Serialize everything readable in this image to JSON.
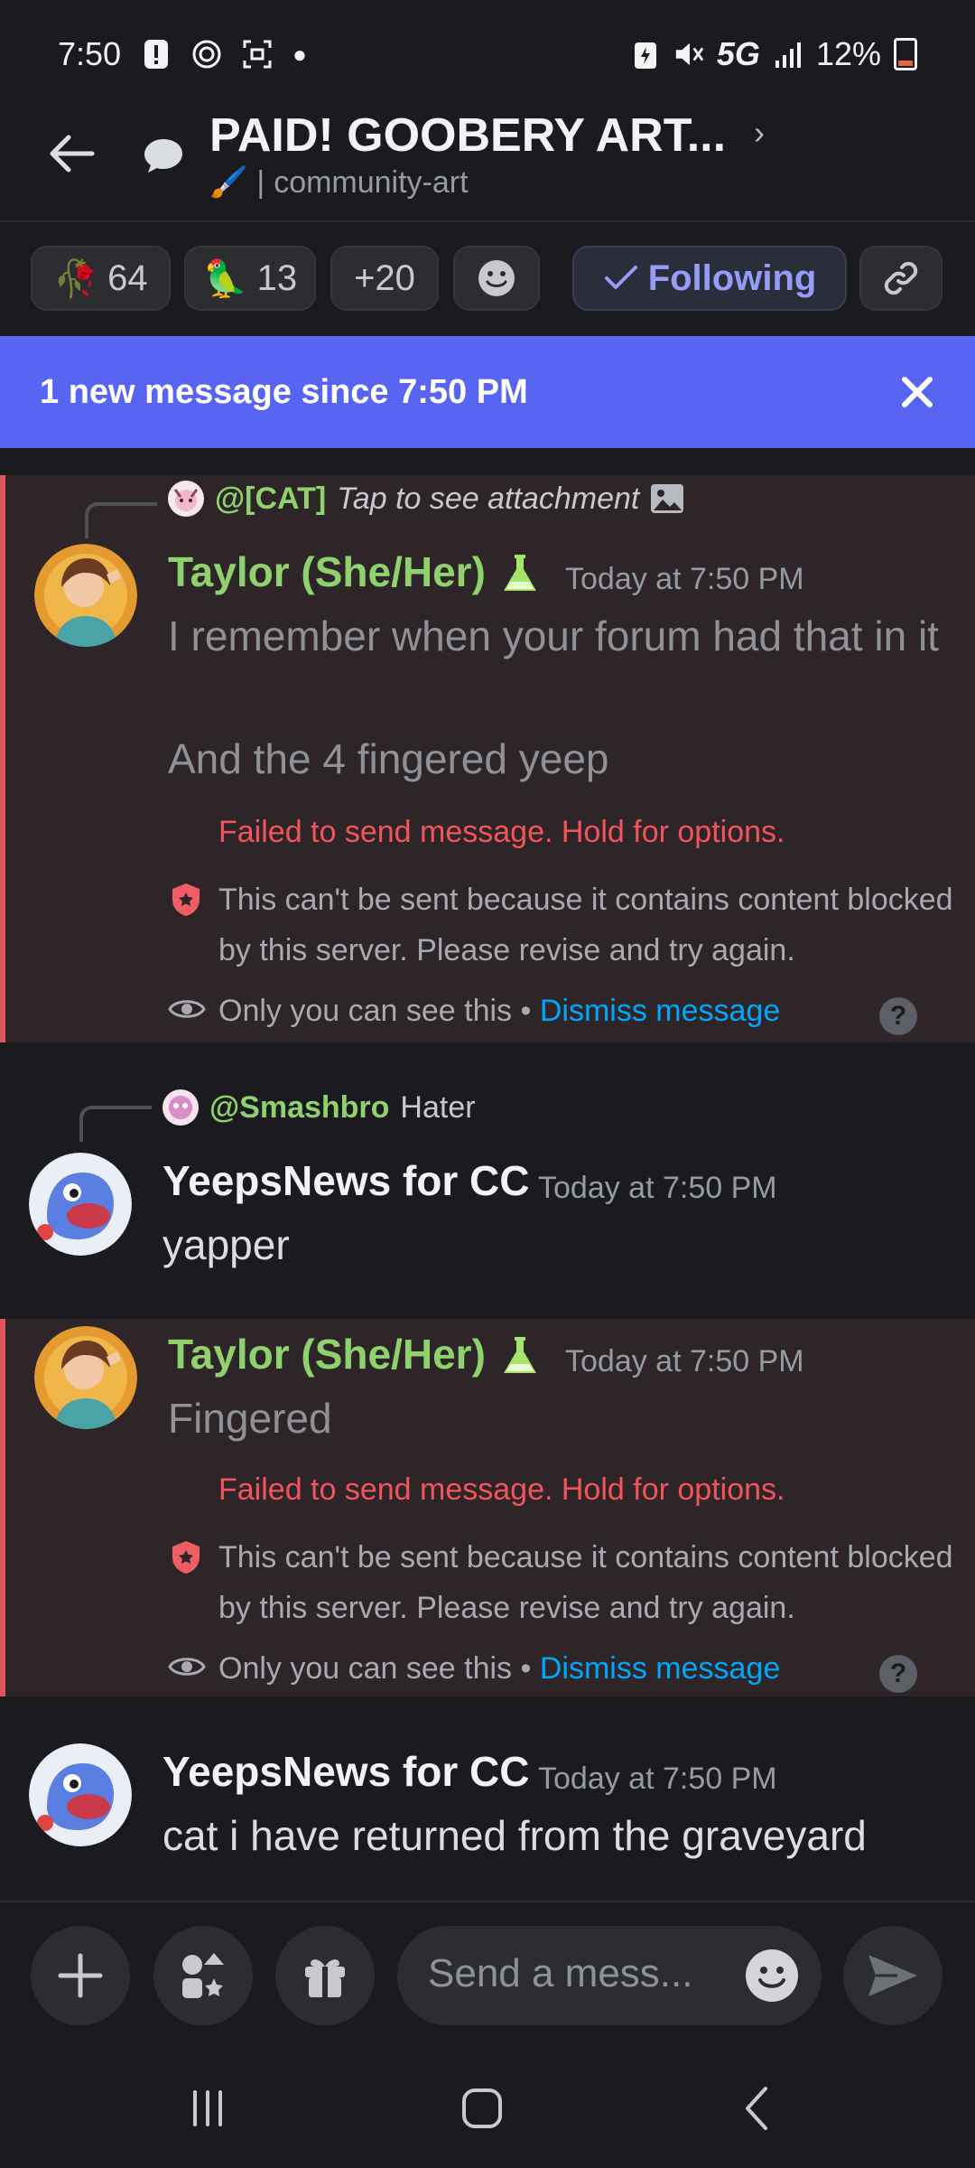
{
  "status_bar": {
    "time": "7:50",
    "network": "5G",
    "battery": "12%"
  },
  "header": {
    "title": "PAID! GOOBERY ART...",
    "subtitle_emoji": "🖌️",
    "channel": "community-art"
  },
  "reactions": [
    {
      "emoji": "🥀",
      "count": "64"
    },
    {
      "emoji": "🦜",
      "count": "13"
    },
    {
      "emoji": "",
      "count": "+20"
    }
  ],
  "actions": {
    "follow_label": "Following"
  },
  "banner": {
    "text": "1 new message since 7:50 PM"
  },
  "messages": [
    {
      "reply": {
        "who": "@[CAT]",
        "what": "Tap to see attachment"
      },
      "author": "Taylor (She/Her)",
      "time": "Today at 7:50 PM",
      "lines": [
        "I remember when your forum had that in it",
        "And the 4 fingered yeep"
      ],
      "failed": "Failed to send message. Hold for options.",
      "blocked": "This can't be sent because it contains content blocked by this server. Please revise and try again.",
      "only": "Only you can see this",
      "dismiss": "Dismiss message"
    },
    {
      "reply": {
        "who": "@Smashbro",
        "what": "Hater"
      },
      "author": "YeepsNews for CC",
      "time": "Today at 7:50 PM",
      "lines": [
        "yapper"
      ]
    },
    {
      "author": "Taylor (She/Her)",
      "time": "Today at 7:50 PM",
      "lines": [
        "Fingered"
      ],
      "failed": "Failed to send message. Hold for options.",
      "blocked": "This can't be sent because it contains content blocked by this server. Please revise and try again.",
      "only": "Only you can see this",
      "dismiss": "Dismiss message"
    },
    {
      "author": "YeepsNews for CC",
      "time": "Today at 7:50 PM",
      "lines": [
        "cat i have returned from  the graveyard"
      ]
    }
  ],
  "composer": {
    "placeholder": "Send a mess..."
  },
  "colors": {
    "accent": "#5865f2",
    "role_green": "#8fd16c",
    "error": "#f2545b",
    "link": "#00a8fc"
  },
  "icons": {
    "back": "arrow-left-icon",
    "thread": "chat-bubble-icon",
    "close": "close-icon",
    "check": "check-icon",
    "link": "link-icon",
    "add": "plus-icon",
    "apps": "apps-icon",
    "gift": "gift-icon",
    "send": "send-icon"
  }
}
